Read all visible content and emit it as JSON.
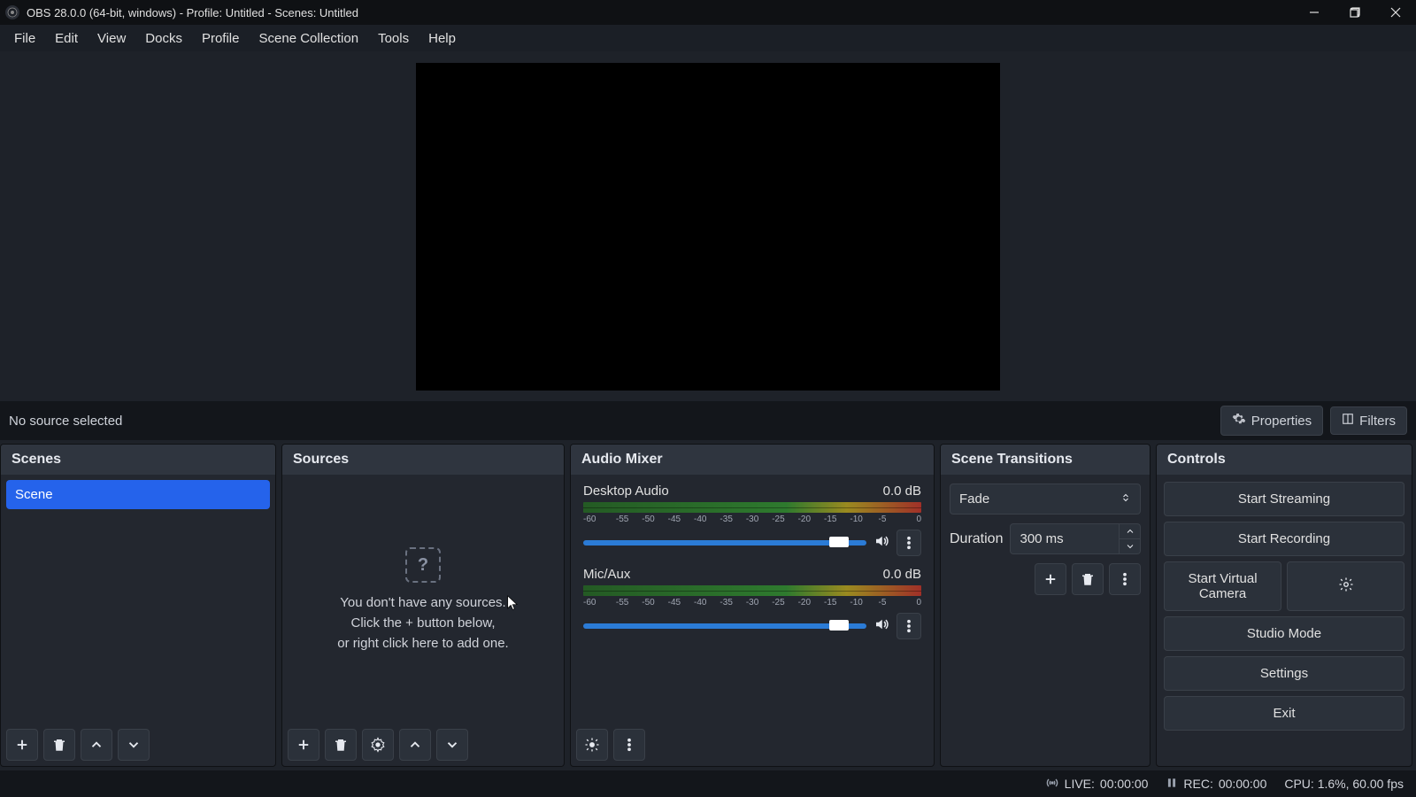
{
  "title": "OBS 28.0.0 (64-bit, windows) - Profile: Untitled - Scenes: Untitled",
  "menu": [
    "File",
    "Edit",
    "View",
    "Docks",
    "Profile",
    "Scene Collection",
    "Tools",
    "Help"
  ],
  "srcbar": {
    "status": "No source selected",
    "properties": "Properties",
    "filters": "Filters"
  },
  "docks": {
    "scenes": {
      "title": "Scenes",
      "items": [
        "Scene"
      ]
    },
    "sources": {
      "title": "Sources",
      "empty1": "You don't have any sources.",
      "empty2": "Click the + button below,",
      "empty3": "or right click here to add one."
    },
    "mixer": {
      "title": "Audio Mixer",
      "ticks": [
        "-60",
        "-55",
        "-50",
        "-45",
        "-40",
        "-35",
        "-30",
        "-25",
        "-20",
        "-15",
        "-10",
        "-5",
        "0"
      ],
      "tracks": [
        {
          "name": "Desktop Audio",
          "db": "0.0 dB"
        },
        {
          "name": "Mic/Aux",
          "db": "0.0 dB"
        }
      ]
    },
    "transitions": {
      "title": "Scene Transitions",
      "selected": "Fade",
      "duration_label": "Duration",
      "duration_value": "300 ms"
    },
    "controls": {
      "title": "Controls",
      "buttons": [
        "Start Streaming",
        "Start Recording",
        "Start Virtual Camera",
        "Studio Mode",
        "Settings",
        "Exit"
      ]
    }
  },
  "status": {
    "live_label": "LIVE:",
    "live_time": "00:00:00",
    "rec_label": "REC:",
    "rec_time": "00:00:00",
    "cpu": "CPU: 1.6%, 60.00 fps"
  }
}
